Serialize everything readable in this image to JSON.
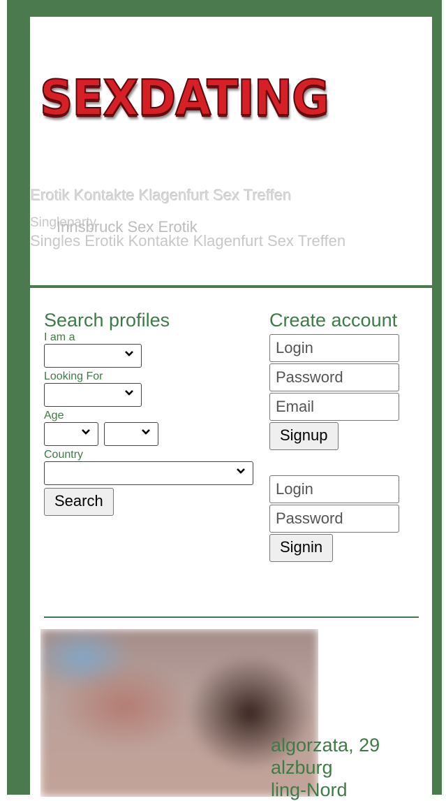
{
  "header": {
    "logo_text": "SEXDATING",
    "links": [
      "Erotik Kontakte Klagenfurt Sex Treffen",
      "Erotik Kontakte Klagenfurt Sex Treffen",
      "Singleparty",
      "Innsbruck Sex Erotik",
      "Singles Erotik Kontakte Klagenfurt Sex Treffen"
    ]
  },
  "search": {
    "title": "Search profiles",
    "i_am_label": "I am a",
    "looking_for_label": "Looking For",
    "age_label": "Age",
    "country_label": "Country",
    "search_button": "Search"
  },
  "account": {
    "title": "Create account",
    "signup_login_placeholder": "Login",
    "signup_password_placeholder": "Password",
    "signup_email_placeholder": "Email",
    "signup_button": "Signup",
    "signin_login_placeholder": "Login",
    "signin_password_placeholder": "Password",
    "signin_button": "Signin"
  },
  "profile": {
    "name_age": "algorzata, 29",
    "city": "alzburg",
    "district": "ling-Nord"
  },
  "colors": {
    "frame_green": "#4a7a4e",
    "text_green": "#3f7b46",
    "logo_red": "#d61f26"
  },
  "icons": {
    "select_arrow": "chevron-down-icon"
  }
}
